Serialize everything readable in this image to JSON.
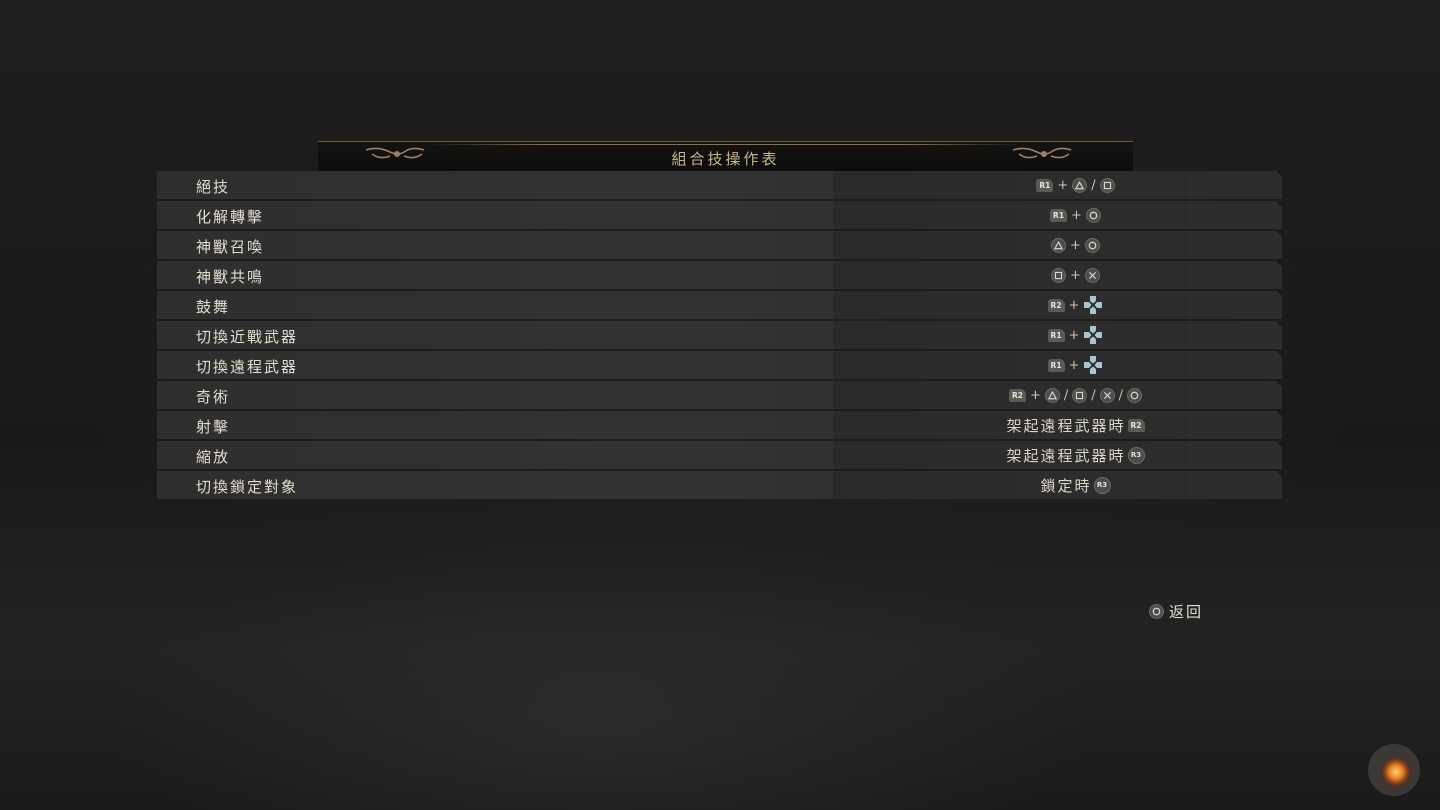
{
  "title": "組合技操作表",
  "rows": [
    {
      "label": "絕技",
      "combo": [
        {
          "type": "tag",
          "text": "R1"
        },
        {
          "type": "sep",
          "text": "+"
        },
        {
          "type": "btn",
          "icon": "triangle-icon"
        },
        {
          "type": "sep",
          "text": "/"
        },
        {
          "type": "btn",
          "icon": "square-icon"
        }
      ]
    },
    {
      "label": "化解轉擊",
      "combo": [
        {
          "type": "tag",
          "text": "R1"
        },
        {
          "type": "sep",
          "text": "+"
        },
        {
          "type": "btn",
          "icon": "circle-icon"
        }
      ]
    },
    {
      "label": "神獸召喚",
      "combo": [
        {
          "type": "btn",
          "icon": "triangle-icon"
        },
        {
          "type": "sep",
          "text": "+"
        },
        {
          "type": "btn",
          "icon": "circle-icon"
        }
      ]
    },
    {
      "label": "神獸共鳴",
      "combo": [
        {
          "type": "btn",
          "icon": "square-icon"
        },
        {
          "type": "sep",
          "text": "+"
        },
        {
          "type": "btn",
          "icon": "cross-icon"
        }
      ]
    },
    {
      "label": "鼓舞",
      "combo": [
        {
          "type": "tag",
          "text": "R2"
        },
        {
          "type": "sep",
          "text": "+"
        },
        {
          "type": "dpad",
          "icon": "dpad-icon"
        }
      ]
    },
    {
      "label": "切換近戰武器",
      "combo": [
        {
          "type": "tag",
          "text": "R1"
        },
        {
          "type": "sep",
          "text": "+"
        },
        {
          "type": "dpad",
          "icon": "dpad-icon"
        }
      ]
    },
    {
      "label": "切換遠程武器",
      "combo": [
        {
          "type": "tag",
          "text": "R1"
        },
        {
          "type": "sep",
          "text": "+"
        },
        {
          "type": "dpad",
          "icon": "dpad-icon"
        }
      ]
    },
    {
      "label": "奇術",
      "combo": [
        {
          "type": "tag",
          "text": "R2"
        },
        {
          "type": "sep",
          "text": "+"
        },
        {
          "type": "btn",
          "icon": "triangle-icon"
        },
        {
          "type": "sep",
          "text": "/"
        },
        {
          "type": "btn",
          "icon": "square-icon"
        },
        {
          "type": "sep",
          "text": "/"
        },
        {
          "type": "btn",
          "icon": "cross-icon"
        },
        {
          "type": "sep",
          "text": "/"
        },
        {
          "type": "btn",
          "icon": "circle-icon"
        }
      ]
    },
    {
      "label": "射擊",
      "combo": [
        {
          "type": "text",
          "text": "架起遠程武器時"
        },
        {
          "type": "tag",
          "text": "R2"
        }
      ]
    },
    {
      "label": "縮放",
      "combo": [
        {
          "type": "text",
          "text": "架起遠程武器時"
        },
        {
          "type": "r3",
          "text": "R3"
        }
      ]
    },
    {
      "label": "切換鎖定對象",
      "combo": [
        {
          "type": "text",
          "text": "鎖定時"
        },
        {
          "type": "r3",
          "text": "R3"
        }
      ]
    }
  ],
  "back": {
    "icon": "circle-icon",
    "label": "返回"
  },
  "colors": {
    "accent_gold": "#c9b48c",
    "text": "#e2dccf",
    "row_bg": "#2f2f2f"
  }
}
